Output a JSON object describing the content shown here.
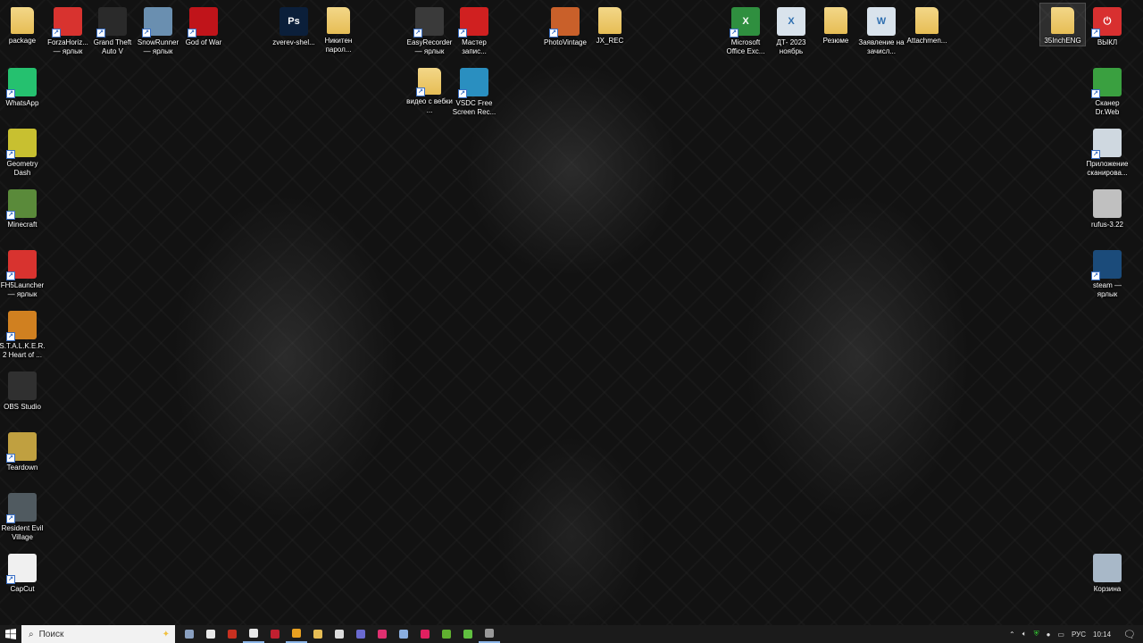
{
  "desktop": {
    "icons": [
      {
        "label": "package",
        "type": "folder",
        "color": "#e6bd55",
        "shortcut": false
      },
      {
        "label": "ForzaHoriz... — ярлык",
        "type": "app",
        "color": "#d8332f",
        "shortcut": true
      },
      {
        "label": "Grand Theft Auto V",
        "type": "app",
        "color": "#2a2a2a",
        "shortcut": true
      },
      {
        "label": "SnowRunner — ярлык",
        "type": "app",
        "color": "#6a8fb0",
        "shortcut": true
      },
      {
        "label": "God of War",
        "type": "app",
        "color": "#c0141a",
        "shortcut": true
      },
      {
        "label": "zverev-shel...",
        "type": "app",
        "color": "#0b1f3a",
        "glyph": "Ps",
        "shortcut": false
      },
      {
        "label": "Никитен парол...",
        "type": "folder",
        "color": "#e6bd55",
        "shortcut": false
      },
      {
        "label": "EasyRecorder — ярлык",
        "type": "app",
        "color": "#3a3a3a",
        "shortcut": true
      },
      {
        "label": "Мастер запис...",
        "type": "app",
        "color": "#d02020",
        "shortcut": true
      },
      {
        "label": "PhotoVintage",
        "type": "app",
        "color": "#c9602a",
        "shortcut": true
      },
      {
        "label": "JX_REC",
        "type": "folder",
        "color": "#e6bd55",
        "shortcut": false
      },
      {
        "label": "Microsoft Office Exc...",
        "type": "app",
        "color": "#2f8f3f",
        "glyph": "X",
        "shortcut": true
      },
      {
        "label": "ДТ- 2023 ноябрь",
        "type": "app",
        "color": "#d9e3ec",
        "glyph": "X",
        "shortcut": false
      },
      {
        "label": "Резюме",
        "type": "folder",
        "color": "#e6bd55",
        "shortcut": false
      },
      {
        "label": "Заявление на зачисл...",
        "type": "app",
        "color": "#d9e3ec",
        "glyph": "W",
        "shortcut": false
      },
      {
        "label": "Attachmen...",
        "type": "folder",
        "color": "#e6bd55",
        "shortcut": false
      },
      {
        "label": "35InchENG",
        "type": "folder",
        "color": "#e6bd55",
        "shortcut": false,
        "selected": true
      },
      {
        "label": "ВЫКЛ",
        "type": "app",
        "color": "#d83030",
        "glyph": "⏻",
        "shortcut": true
      },
      {
        "label": "WhatsApp",
        "type": "app",
        "color": "#25c16f",
        "shortcut": true
      },
      {
        "label": "видео с вебки ...",
        "type": "folder",
        "color": "#e6bd55",
        "shortcut": true
      },
      {
        "label": "VSDC Free Screen Rec...",
        "type": "app",
        "color": "#2a8fc0",
        "shortcut": true
      },
      {
        "label": "Сканер Dr.Web",
        "type": "app",
        "color": "#3aa040",
        "shortcut": true
      },
      {
        "label": "Geometry Dash",
        "type": "app",
        "color": "#c8c030",
        "shortcut": true
      },
      {
        "label": "Minecraft",
        "type": "app",
        "color": "#5a8a3a",
        "shortcut": true
      },
      {
        "label": "FH5Launcher — ярлык",
        "type": "app",
        "color": "#d8332f",
        "shortcut": true
      },
      {
        "label": "S.T.A.L.K.E.R. 2 Heart of ...",
        "type": "app",
        "color": "#d08020",
        "shortcut": true
      },
      {
        "label": "OBS Studio",
        "type": "app",
        "color": "#303030",
        "shortcut": false
      },
      {
        "label": "Teardown",
        "type": "app",
        "color": "#c0a040",
        "shortcut": true
      },
      {
        "label": "Resident Evil Village",
        "type": "app",
        "color": "#505a60",
        "shortcut": true
      },
      {
        "label": "CapCut",
        "type": "app",
        "color": "#f0f0f0",
        "shortcut": true
      },
      {
        "label": "Приложение сканирова...",
        "type": "app",
        "color": "#cfd8e0",
        "shortcut": true
      },
      {
        "label": "rufus-3.22",
        "type": "app",
        "color": "#c0c0c0",
        "shortcut": false
      },
      {
        "label": "steam — ярлык",
        "type": "app",
        "color": "#1b4b7a",
        "shortcut": true
      },
      {
        "label": "Корзина",
        "type": "app",
        "color": "#a8b8c8",
        "shortcut": false
      }
    ]
  },
  "taskbar": {
    "search_placeholder": "Поиск",
    "pinned": [
      {
        "name": "task-view",
        "color": "#8aa0c0"
      },
      {
        "name": "calendar-app",
        "color": "#e8e8e8"
      },
      {
        "name": "app-orange",
        "color": "#c83020"
      },
      {
        "name": "yandex-browser",
        "color": "#e8e8e8",
        "open": true
      },
      {
        "name": "aida64",
        "color": "#c02030"
      },
      {
        "name": "app-power",
        "color": "#e8a020",
        "open": true
      },
      {
        "name": "file-explorer",
        "color": "#e6bd55"
      },
      {
        "name": "settings",
        "color": "#dddddd"
      },
      {
        "name": "app-z",
        "color": "#6a6ad0"
      },
      {
        "name": "app-pink",
        "color": "#e03070"
      },
      {
        "name": "notepad",
        "color": "#8aaee0"
      },
      {
        "name": "recorder",
        "color": "#e02060"
      },
      {
        "name": "nvidia",
        "color": "#60b030"
      },
      {
        "name": "utorrent",
        "color": "#60c040"
      },
      {
        "name": "app-gear",
        "color": "#999999",
        "open": true
      }
    ],
    "tray": {
      "language": "РУС",
      "time": "10:14"
    }
  }
}
